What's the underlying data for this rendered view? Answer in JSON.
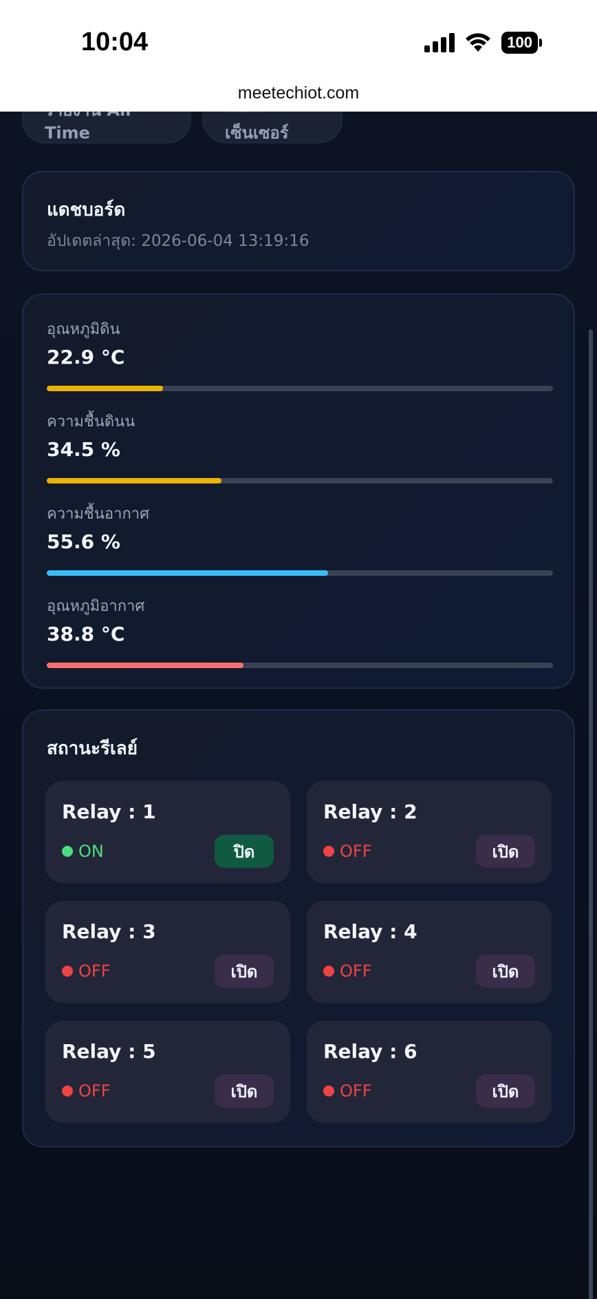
{
  "status_bar": {
    "time": "10:04",
    "battery": "100"
  },
  "browser": {
    "url": "meetechiot.com"
  },
  "nav": {
    "items": [
      {
        "label": "รายงาน Air Time"
      },
      {
        "label": "ตั้งค่าเซ็นเซอร์"
      }
    ]
  },
  "dashboard": {
    "title": "แดชบอร์ด",
    "updated": "อัปเดตล่าสุด: 2026-06-04 13:19:16"
  },
  "sensors": [
    {
      "label": "อุณหภูมิดิน",
      "value": "22.9 °C",
      "level": 0.23,
      "color": "#eab308"
    },
    {
      "label": "ความชื้นดินน",
      "value": "34.5 %",
      "level": 0.345,
      "color": "#eab308"
    },
    {
      "label": "ความชื้นอากาศ",
      "value": "55.6 %",
      "level": 0.556,
      "color": "#38bdf8"
    },
    {
      "label": "อุณหภูมิอากาศ",
      "value": "38.8 °C",
      "level": 0.388,
      "color": "#f87171"
    }
  ],
  "relays": {
    "title": "สถานะรีเลย์",
    "items": [
      {
        "name": "Relay : 1",
        "state": "ON",
        "button": "ปิด"
      },
      {
        "name": "Relay : 2",
        "state": "OFF",
        "button": "เปิด"
      },
      {
        "name": "Relay : 3",
        "state": "OFF",
        "button": "เปิด"
      },
      {
        "name": "Relay : 4",
        "state": "OFF",
        "button": "เปิด"
      },
      {
        "name": "Relay : 5",
        "state": "OFF",
        "button": "เปิด"
      },
      {
        "name": "Relay : 6",
        "state": "OFF",
        "button": "เปิด"
      }
    ]
  },
  "colors": {
    "on": "#4ade80",
    "off": "#ef4444",
    "on_button_bg": "#0f5a40",
    "off_button_bg": "#3a2d4a"
  }
}
